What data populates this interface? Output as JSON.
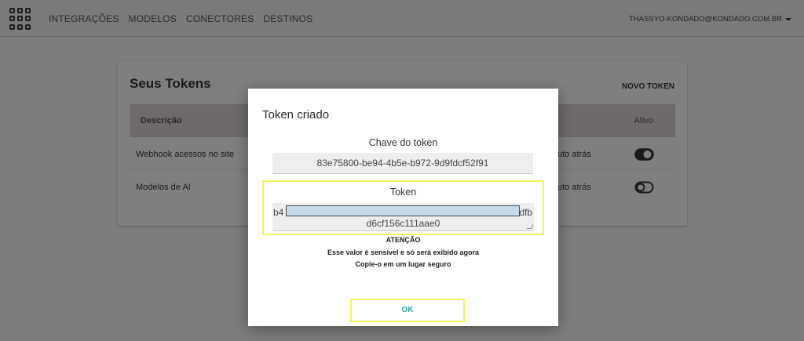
{
  "nav": {
    "links": [
      "INTEGRAÇÕES",
      "MODELOS",
      "CONECTORES",
      "DESTINOS"
    ],
    "user_email": "THASSYO-KONDADO@KONDADO.COM.BR"
  },
  "tokens_page": {
    "title": "Seus Tokens",
    "new_token_label": "NOVO TOKEN",
    "columns": {
      "description": "Descrição",
      "active": "Ativo"
    },
    "rows": [
      {
        "description": "Webhook acessos no site",
        "when": "uto atrás",
        "active": true
      },
      {
        "description": "Modelos de AI",
        "when": "uto atrás",
        "active": false
      }
    ]
  },
  "modal": {
    "title": "Token criado",
    "key_label": "Chave do token",
    "key_value": "83e75800-be94-4b5e-b972-9d9fdcf52f91",
    "token_label": "Token",
    "token_start": "b4",
    "token_end": "dfb",
    "token_line2": "d6cf156c111aae0",
    "warning_title": "ATENÇÃO",
    "warning_line1": "Esse valor é sensível e só será exibido agora",
    "warning_line2": "Copie-o em um lugar seguro",
    "ok_label": "OK"
  },
  "colors": {
    "overlay_bg": "#7d7d7d",
    "highlight": "#f3f35a",
    "ok_text": "#2ba3a3",
    "redaction": "#c5daea"
  }
}
